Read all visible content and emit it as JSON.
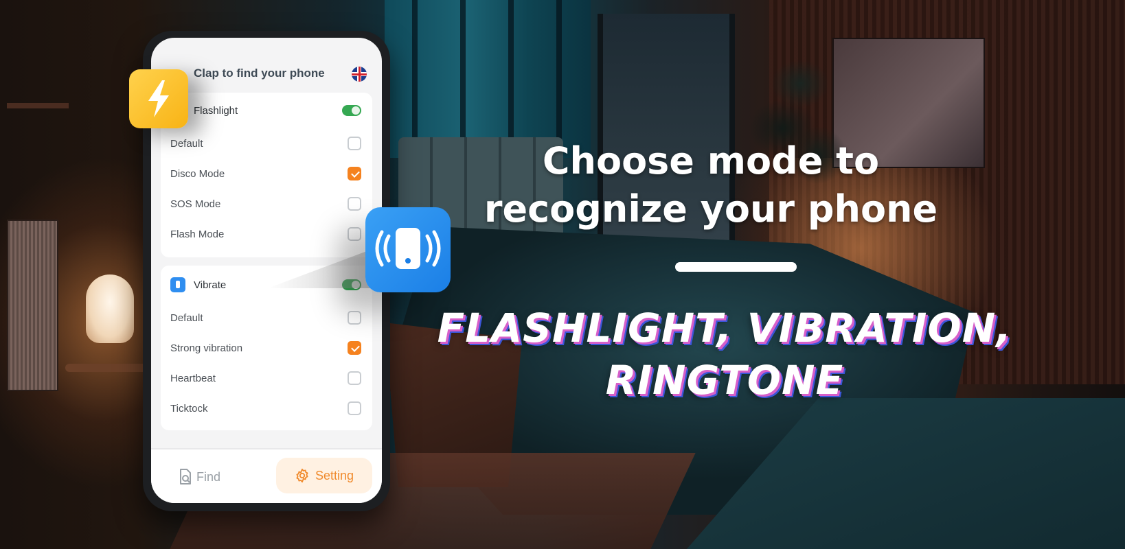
{
  "app": {
    "title": "Clap to find your phone",
    "language_flag": "uk-flag-icon"
  },
  "flashlight_section": {
    "label": "Flashlight",
    "enabled": true,
    "options": [
      {
        "label": "Default",
        "checked": false
      },
      {
        "label": "Disco Mode",
        "checked": true
      },
      {
        "label": "SOS Mode",
        "checked": false
      },
      {
        "label": "Flash Mode",
        "checked": false
      }
    ]
  },
  "vibrate_section": {
    "label": "Vibrate",
    "enabled": true,
    "options": [
      {
        "label": "Default",
        "checked": false
      },
      {
        "label": "Strong vibration",
        "checked": true
      },
      {
        "label": "Heartbeat",
        "checked": false
      },
      {
        "label": "Ticktock",
        "checked": false
      }
    ]
  },
  "bottom_nav": {
    "find_label": "Find",
    "setting_label": "Setting",
    "active": "Setting"
  },
  "promo": {
    "headline_line1": "Choose mode to",
    "headline_line2": "recognize your phone",
    "modes_line1": "FLASHLIGHT, VIBRATION,",
    "modes_line2": "RINGTONE"
  },
  "colors": {
    "accent_orange": "#f5821f",
    "toggle_green": "#35a852",
    "flash_yellow": "#f8b315",
    "vibrate_blue": "#1b7fe6",
    "shadow_pink": "#d65fc9",
    "shadow_blue": "#3b56d8"
  }
}
